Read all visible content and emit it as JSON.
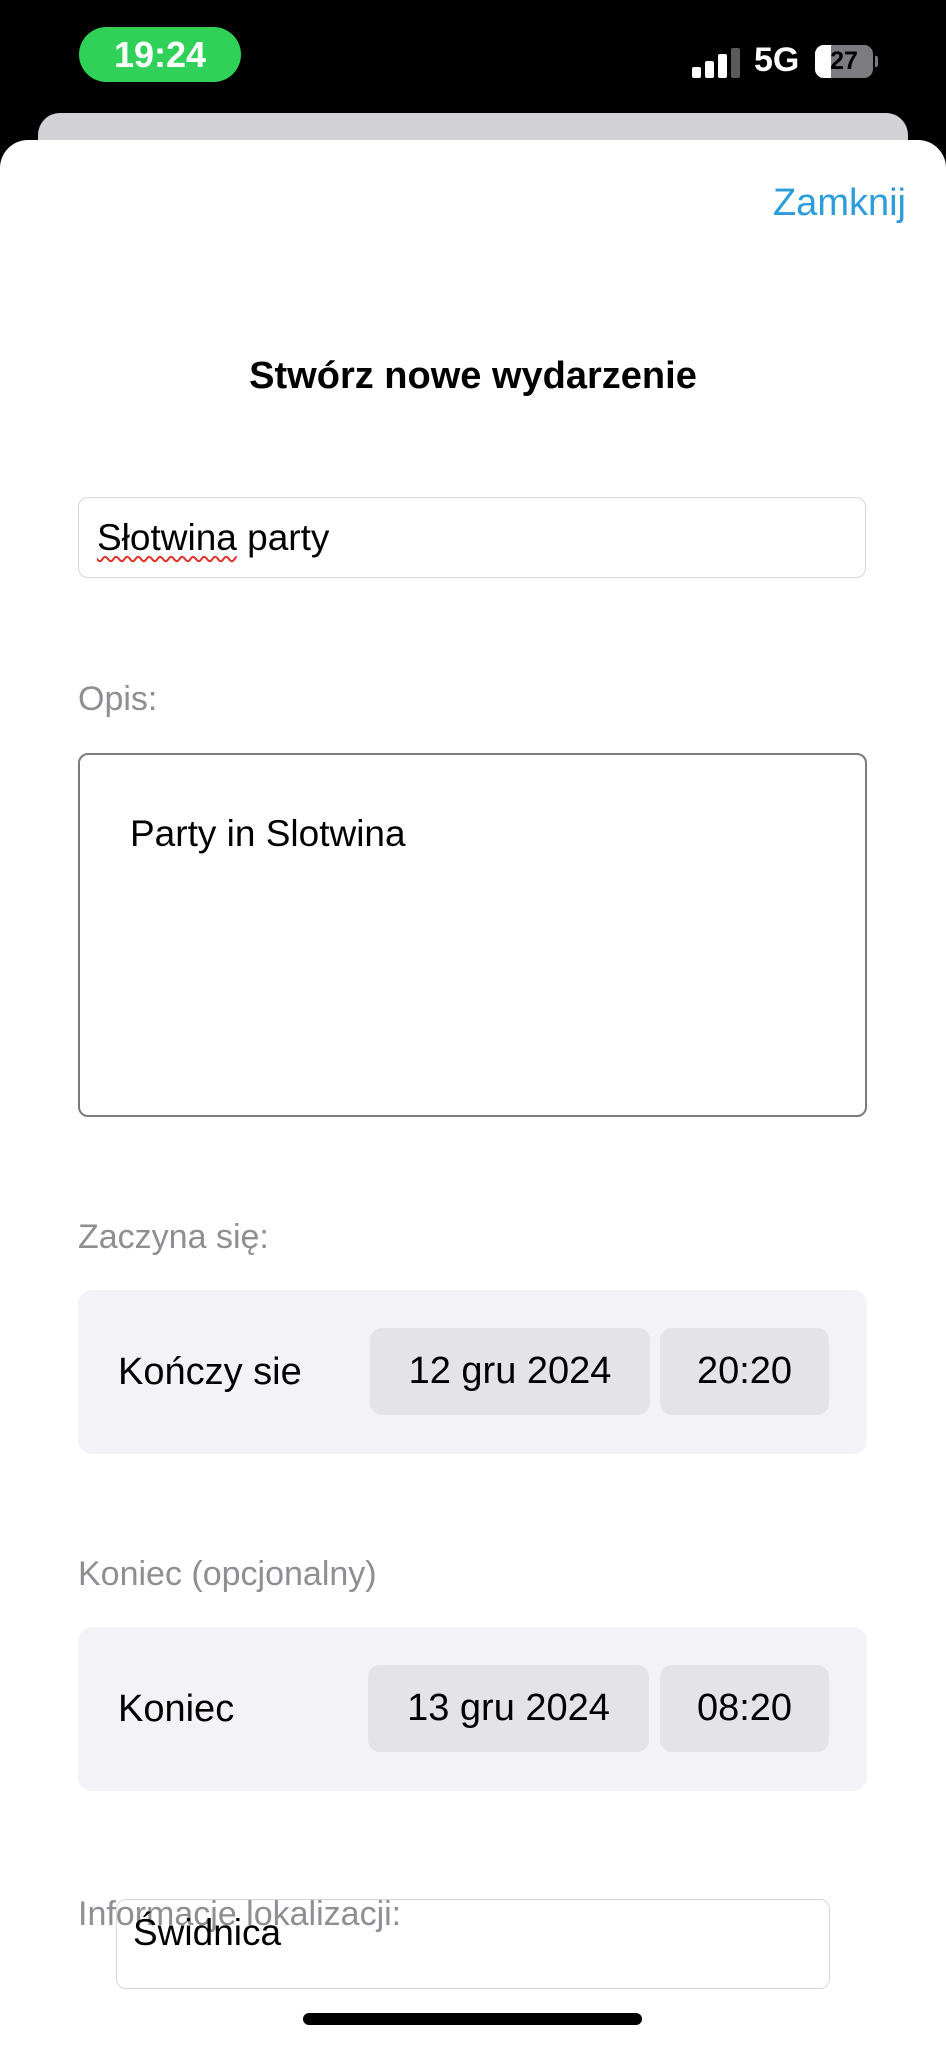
{
  "status_bar": {
    "time": "19:24",
    "network": "5G",
    "battery": "27",
    "battery_level": 0.27,
    "colors": {
      "time_pill": "#30d158"
    }
  },
  "sheet": {
    "close_label": "Zamknij",
    "title": "Stwórz nowe wydarzenie",
    "name_value_misspelled": "Słotwina",
    "name_value_rest": " party",
    "description_label": "Opis:",
    "description_value": "Party in Slotwina",
    "start": {
      "section_label": "Zaczyna się:",
      "row_label": "Kończy sie",
      "date": "12 gru 2024",
      "time": "20:20"
    },
    "end": {
      "section_label": "Koniec (opcjonalny)",
      "row_label": "Koniec",
      "date": "13 gru 2024",
      "time": "08:20"
    },
    "location": {
      "section_label": "Informacje lokalizacji:",
      "value": "Świdnica"
    }
  },
  "colors": {
    "accent": "#2d9cdb",
    "secondary_text": "#8e8e93",
    "row_background": "#f2f2f7",
    "chip_background": "#e3e3e8"
  },
  "icons": [
    "cellular-signal-icon",
    "battery-icon"
  ]
}
